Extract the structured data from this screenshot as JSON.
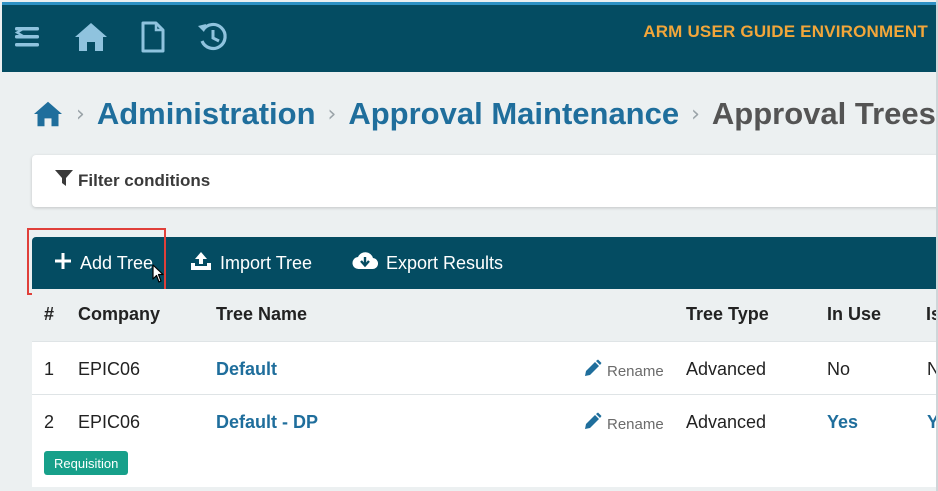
{
  "header": {
    "environment_label": "ARM USER GUIDE ENVIRONMENT",
    "icons": [
      "menu-icon",
      "home-icon",
      "document-icon",
      "history-icon"
    ]
  },
  "breadcrumb": {
    "items": [
      {
        "label": "Administration"
      },
      {
        "label": "Approval Maintenance"
      }
    ],
    "current": "Approval Trees"
  },
  "filter": {
    "label": "Filter conditions"
  },
  "toolbar": {
    "add_tree": "Add Tree",
    "import_tree": "Import Tree",
    "export_results": "Export Results"
  },
  "table": {
    "columns": [
      "#",
      "Company",
      "Tree Name",
      "Tree Type",
      "In Use",
      "Is"
    ],
    "rename_label": "Rename",
    "rows": [
      {
        "num": "1",
        "company": "EPIC06",
        "tree_name": "Default",
        "tree_type": "Advanced",
        "in_use": "No",
        "is": "N"
      },
      {
        "num": "2",
        "company": "EPIC06",
        "tree_name": "Default - DP",
        "tree_type": "Advanced",
        "in_use": "Yes",
        "is": "Y",
        "badge": "Requisition"
      }
    ]
  },
  "colors": {
    "header_bg": "#044c62",
    "accent_orange": "#f2a63a",
    "link_blue": "#1f6e9c",
    "badge_green": "#17a08a",
    "highlight_red": "#e0403a"
  }
}
